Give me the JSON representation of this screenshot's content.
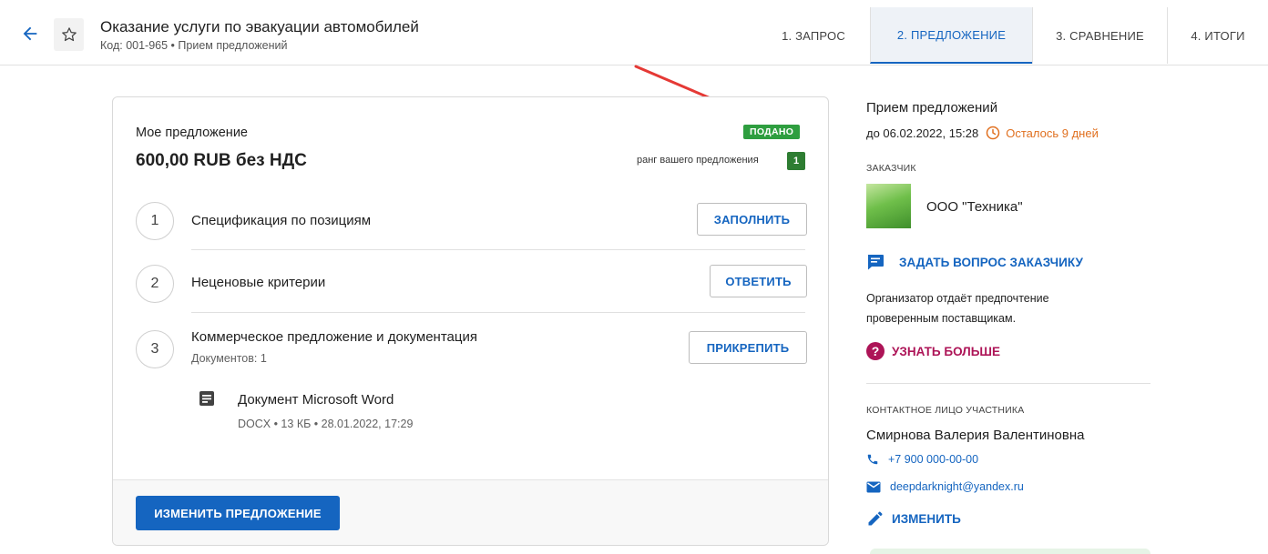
{
  "header": {
    "title": "Оказание услуги по эвакуации автомобилей",
    "subtitle": "Код: 001-965 • Прием предложений",
    "tabs": [
      {
        "label": "1. ЗАПРОС"
      },
      {
        "label": "2. ПРЕДЛОЖЕНИЕ"
      },
      {
        "label": "3. СРАВНЕНИЕ"
      },
      {
        "label": "4. ИТОГИ"
      }
    ],
    "active_tab": "2. ПРЕДЛОЖЕНИЕ"
  },
  "offer": {
    "label": "Мое предложение",
    "price": "600,00 RUB без НДС",
    "status_badge": "ПОДАНО",
    "rank_label": "ранг вашего предложения",
    "rank": "1",
    "steps": [
      {
        "number": "1",
        "label": "Спецификация по позициям",
        "button": "ЗАПОЛНИТЬ"
      },
      {
        "number": "2",
        "label": "Неценовые критерии",
        "button": "ОТВЕТИТЬ"
      },
      {
        "number": "3",
        "label": "Коммерческое предложение и документация",
        "sub": "Документов: 1",
        "button": "ПРИКРЕПИТЬ"
      }
    ],
    "document": {
      "name": "Документ Microsoft Word",
      "meta": "DOCX • 13 КБ • 28.01.2022, 17:29"
    },
    "change_button": "ИЗМЕНИТЬ ПРЕДЛОЖЕНИЕ"
  },
  "sidebar": {
    "stage_title": "Прием предложений",
    "deadline": "до 06.02.2022, 15:28",
    "remaining": "Осталось 9 дней",
    "customer_label": "ЗАКАЗЧИК",
    "customer_name": "ООО \"Техника\"",
    "ask_link": "ЗАДАТЬ ВОПРОС ЗАКАЗЧИКУ",
    "organizer_note": "Организатор отдаёт предпочтение проверенным поставщикам.",
    "learn_more": "УЗНАТЬ БОЛЬШЕ",
    "contact_label": "КОНТАКТНОЕ ЛИЦО УЧАСТНИКА",
    "contact_name": "Смирнова Валерия Валентиновна",
    "phone": "+7 900 000-00-00",
    "email": "deepdarknight@yandex.ru",
    "edit_link": "ИЗМЕНИТЬ"
  },
  "colors": {
    "primary": "#1565c0",
    "success": "#2e9e3f",
    "warning": "#e07020",
    "accent": "#ad1457",
    "annotation_arrow": "#e53935"
  }
}
